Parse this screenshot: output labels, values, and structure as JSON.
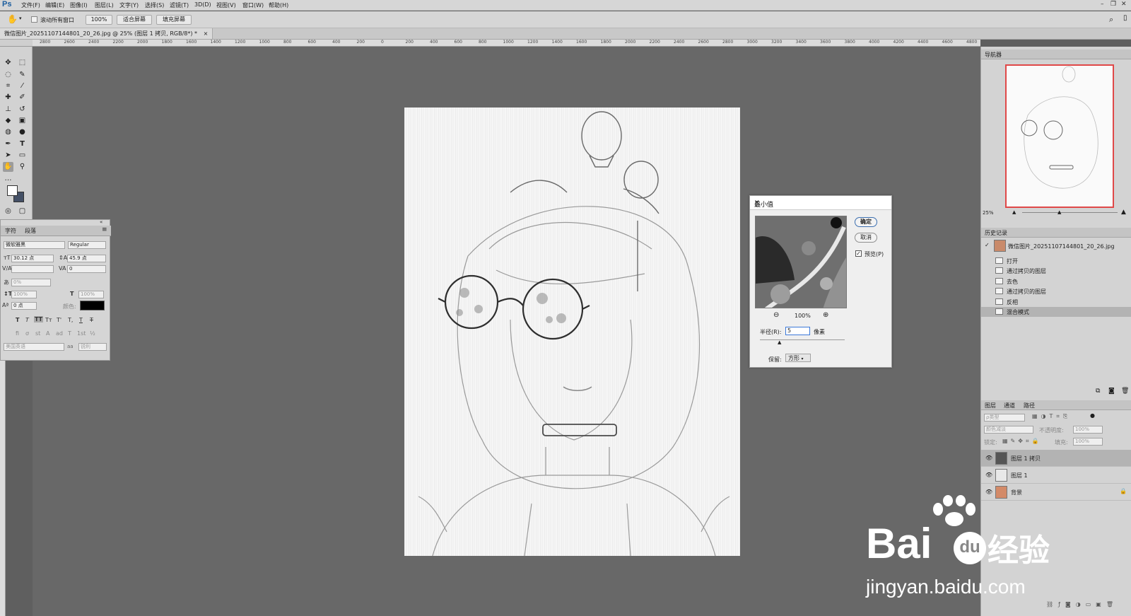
{
  "app": {
    "logo": "Ps"
  },
  "menu": [
    "文件(F)",
    "编辑(E)",
    "图像(I)",
    "图层(L)",
    "文字(Y)",
    "选择(S)",
    "滤镜(T)",
    "3D(D)",
    "视图(V)",
    "窗口(W)",
    "帮助(H)"
  ],
  "options": {
    "scroll_all_windows": "滚动所有窗口",
    "zoom": "100%",
    "fit_screen": "适合屏幕",
    "fill_screen": "填充屏幕"
  },
  "document_tab": {
    "title": "微信图片_20251107144801_20_26.jpg @ 25% (图层 1 拷贝, RGB/8*) *",
    "close": "×"
  },
  "ruler_ticks": [
    "2800",
    "2600",
    "2400",
    "2200",
    "2000",
    "1800",
    "1600",
    "1400",
    "1200",
    "1000",
    "800",
    "600",
    "400",
    "200",
    "0",
    "200",
    "400",
    "600",
    "800",
    "1000",
    "1200",
    "1400",
    "1600",
    "1800",
    "2000",
    "2200",
    "2400",
    "2600",
    "2800",
    "3000",
    "3200",
    "3400",
    "3600",
    "3800",
    "4000",
    "4200",
    "4400",
    "4600",
    "4800"
  ],
  "char_panel": {
    "tabs": [
      "字符",
      "段落"
    ],
    "font_family": "微软雅黑",
    "font_style": "Regular",
    "font_size": "30.12 点",
    "leading": "45.9 点",
    "kerning": "",
    "tracking": "0",
    "scale_pct": "0%",
    "vertical_scale": "100%",
    "horizontal_scale": "100%",
    "baseline": "0 点",
    "color_label": "颜色:",
    "color": "#000000",
    "style_glyphs": [
      "T",
      "T",
      "TT",
      "Tт",
      "T'",
      "T,",
      "T",
      "T"
    ],
    "opentype_glyphs": [
      "fi",
      "ơ",
      "st",
      "A",
      "ad",
      "T",
      "1st",
      "½"
    ],
    "language": "美国英语",
    "aa_label": "aa",
    "aa_mode": "锐利"
  },
  "dialog": {
    "title": "最小值",
    "ok": "确定",
    "cancel": "取消",
    "preview_label": "预览(P)",
    "preview_checked": true,
    "zoom": "100%",
    "radius_label": "半径(R):",
    "radius_value": "5",
    "radius_unit": "像素",
    "preserve_label": "保留:",
    "preserve_value": "方形"
  },
  "navigator": {
    "title": "导航器",
    "zoom": "25%"
  },
  "history": {
    "title": "历史记录",
    "snapshot": "微信图片_20251107144801_20_26.jpg",
    "items": [
      {
        "label": "打开"
      },
      {
        "label": "通过拷贝的图层"
      },
      {
        "label": "去色"
      },
      {
        "label": "通过拷贝的图层"
      },
      {
        "label": "反相"
      },
      {
        "label": "混合模式",
        "selected": true
      }
    ]
  },
  "layers": {
    "tabs": [
      "图层",
      "通道",
      "路径"
    ],
    "filter_kind": "ρ类型",
    "blend_mode": "颜色减淡",
    "opacity_label": "不透明度:",
    "opacity": "100%",
    "lock_label": "锁定:",
    "fill_label": "填充:",
    "fill": "100%",
    "items": [
      {
        "name": "图层 1 拷贝",
        "selected": true
      },
      {
        "name": "图层 1"
      },
      {
        "name": "背景",
        "locked": true
      }
    ]
  },
  "watermark": {
    "brand": "Bai",
    "du": "du",
    "jingyan": "经验",
    "url": "jingyan.baidu.com"
  }
}
